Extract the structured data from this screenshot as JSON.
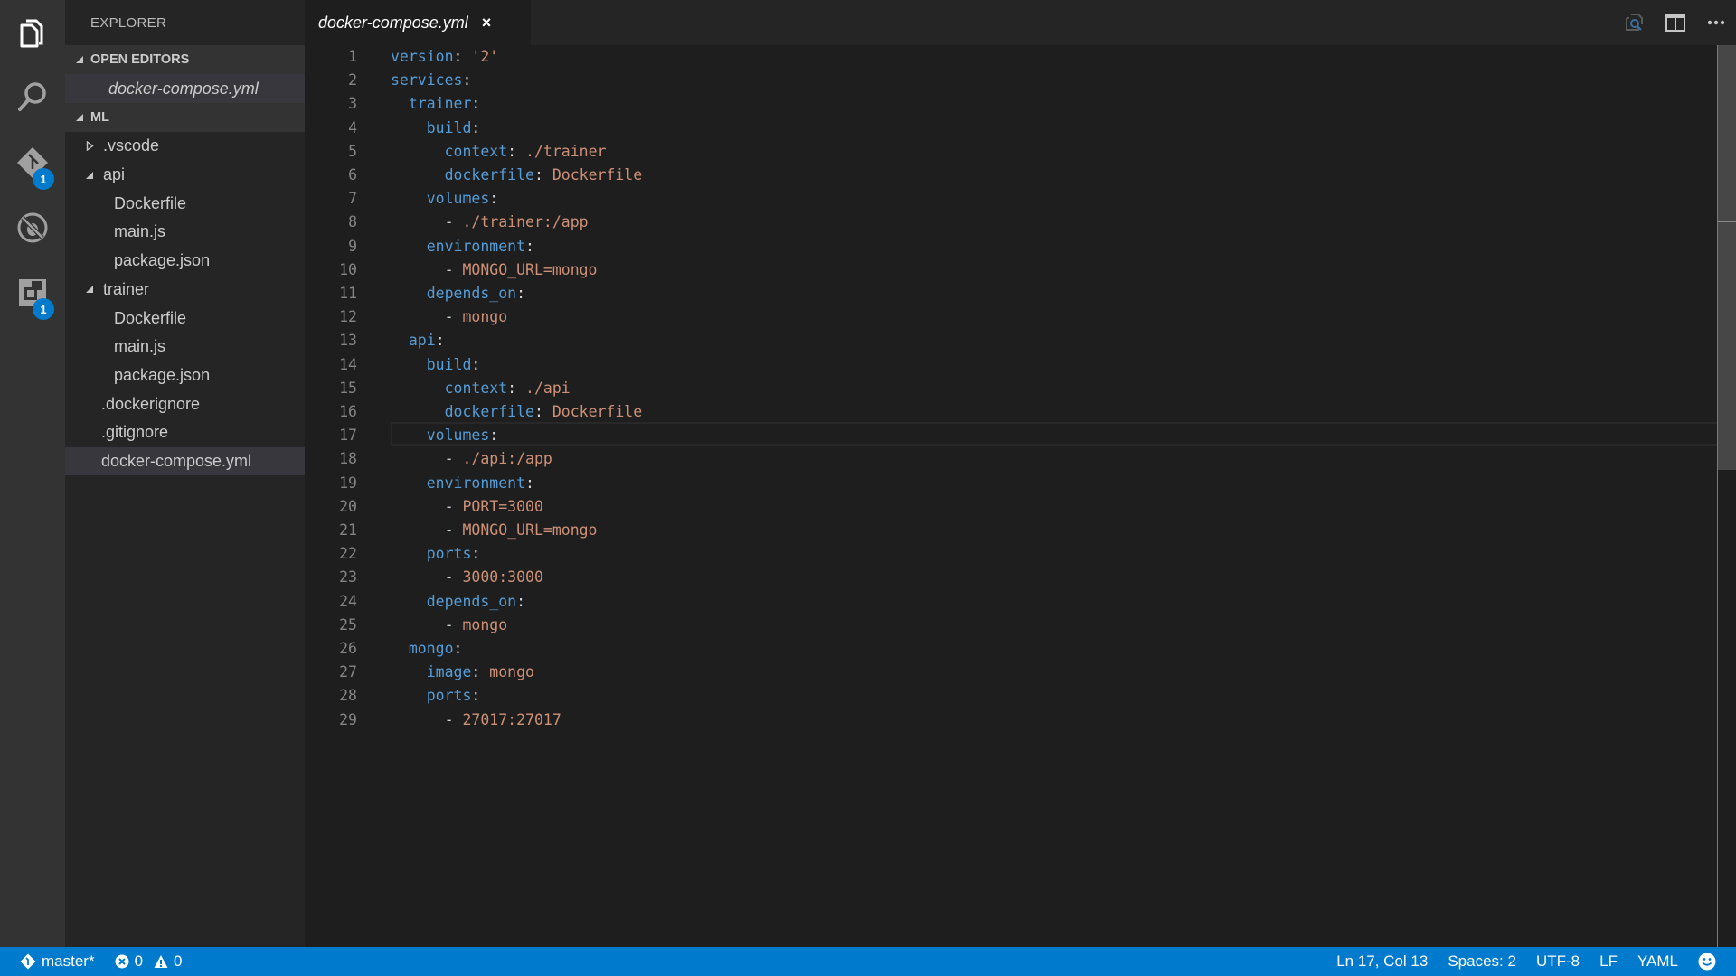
{
  "activitybar": {
    "items": [
      {
        "name": "explorer",
        "icon": "files-icon",
        "active": true
      },
      {
        "name": "search",
        "icon": "search-icon"
      },
      {
        "name": "source-control",
        "icon": "git-icon",
        "badge": "1"
      },
      {
        "name": "debug",
        "icon": "debug-icon"
      },
      {
        "name": "extensions",
        "icon": "extensions-icon",
        "badge": "1"
      }
    ]
  },
  "sidebar": {
    "title": "EXPLORER",
    "open_editors": {
      "header": "OPEN EDITORS",
      "items": [
        "docker-compose.yml"
      ]
    },
    "folder": {
      "header": "ML",
      "tree": [
        {
          "label": ".vscode",
          "type": "folder",
          "expanded": false,
          "depth": 0
        },
        {
          "label": "api",
          "type": "folder",
          "expanded": true,
          "depth": 0
        },
        {
          "label": "Dockerfile",
          "type": "file",
          "depth": 1
        },
        {
          "label": "main.js",
          "type": "file",
          "depth": 1
        },
        {
          "label": "package.json",
          "type": "file",
          "depth": 1
        },
        {
          "label": "trainer",
          "type": "folder",
          "expanded": true,
          "depth": 0
        },
        {
          "label": "Dockerfile",
          "type": "file",
          "depth": 1
        },
        {
          "label": "main.js",
          "type": "file",
          "depth": 1
        },
        {
          "label": "package.json",
          "type": "file",
          "depth": 1
        },
        {
          "label": ".dockerignore",
          "type": "file",
          "depth": 0
        },
        {
          "label": ".gitignore",
          "type": "file",
          "depth": 0
        },
        {
          "label": "docker-compose.yml",
          "type": "file",
          "depth": 0,
          "selected": true
        }
      ]
    }
  },
  "tabs": [
    {
      "label": "docker-compose.yml",
      "active": true,
      "close": "×"
    }
  ],
  "editor": {
    "current_line": 17,
    "lines": [
      [
        {
          "t": "version",
          "c": "k"
        },
        {
          "t": ": ",
          "c": "p"
        },
        {
          "t": "'2'",
          "c": "v"
        }
      ],
      [
        {
          "t": "services",
          "c": "k"
        },
        {
          "t": ":",
          "c": "p"
        }
      ],
      [
        {
          "t": "  "
        },
        {
          "t": "trainer",
          "c": "k"
        },
        {
          "t": ":",
          "c": "p"
        }
      ],
      [
        {
          "t": "    "
        },
        {
          "t": "build",
          "c": "k"
        },
        {
          "t": ":",
          "c": "p"
        }
      ],
      [
        {
          "t": "      "
        },
        {
          "t": "context",
          "c": "k"
        },
        {
          "t": ": ",
          "c": "p"
        },
        {
          "t": "./trainer",
          "c": "v"
        }
      ],
      [
        {
          "t": "      "
        },
        {
          "t": "dockerfile",
          "c": "k"
        },
        {
          "t": ": ",
          "c": "p"
        },
        {
          "t": "Dockerfile",
          "c": "v"
        }
      ],
      [
        {
          "t": "    "
        },
        {
          "t": "volumes",
          "c": "k"
        },
        {
          "t": ":",
          "c": "p"
        }
      ],
      [
        {
          "t": "      "
        },
        {
          "t": "- ",
          "c": "p"
        },
        {
          "t": "./trainer:/app",
          "c": "v"
        }
      ],
      [
        {
          "t": "    "
        },
        {
          "t": "environment",
          "c": "k"
        },
        {
          "t": ":",
          "c": "p"
        }
      ],
      [
        {
          "t": "      "
        },
        {
          "t": "- ",
          "c": "p"
        },
        {
          "t": "MONGO_URL=mongo",
          "c": "v"
        }
      ],
      [
        {
          "t": "    "
        },
        {
          "t": "depends_on",
          "c": "k"
        },
        {
          "t": ":",
          "c": "p"
        }
      ],
      [
        {
          "t": "      "
        },
        {
          "t": "- ",
          "c": "p"
        },
        {
          "t": "mongo",
          "c": "v"
        }
      ],
      [
        {
          "t": "  "
        },
        {
          "t": "api",
          "c": "k"
        },
        {
          "t": ":",
          "c": "p"
        }
      ],
      [
        {
          "t": "    "
        },
        {
          "t": "build",
          "c": "k"
        },
        {
          "t": ":",
          "c": "p"
        }
      ],
      [
        {
          "t": "      "
        },
        {
          "t": "context",
          "c": "k"
        },
        {
          "t": ": ",
          "c": "p"
        },
        {
          "t": "./api",
          "c": "v"
        }
      ],
      [
        {
          "t": "      "
        },
        {
          "t": "dockerfile",
          "c": "k"
        },
        {
          "t": ": ",
          "c": "p"
        },
        {
          "t": "Dockerfile",
          "c": "v"
        }
      ],
      [
        {
          "t": "    "
        },
        {
          "t": "volumes",
          "c": "k"
        },
        {
          "t": ":",
          "c": "p"
        }
      ],
      [
        {
          "t": "      "
        },
        {
          "t": "- ",
          "c": "p"
        },
        {
          "t": "./api:/app",
          "c": "v"
        }
      ],
      [
        {
          "t": "    "
        },
        {
          "t": "environment",
          "c": "k"
        },
        {
          "t": ":",
          "c": "p"
        }
      ],
      [
        {
          "t": "      "
        },
        {
          "t": "- ",
          "c": "p"
        },
        {
          "t": "PORT=3000",
          "c": "v"
        }
      ],
      [
        {
          "t": "      "
        },
        {
          "t": "- ",
          "c": "p"
        },
        {
          "t": "MONGO_URL=mongo",
          "c": "v"
        }
      ],
      [
        {
          "t": "    "
        },
        {
          "t": "ports",
          "c": "k"
        },
        {
          "t": ":",
          "c": "p"
        }
      ],
      [
        {
          "t": "      "
        },
        {
          "t": "- ",
          "c": "p"
        },
        {
          "t": "3000:3000",
          "c": "v"
        }
      ],
      [
        {
          "t": "    "
        },
        {
          "t": "depends_on",
          "c": "k"
        },
        {
          "t": ":",
          "c": "p"
        }
      ],
      [
        {
          "t": "      "
        },
        {
          "t": "- ",
          "c": "p"
        },
        {
          "t": "mongo",
          "c": "v"
        }
      ],
      [
        {
          "t": "  "
        },
        {
          "t": "mongo",
          "c": "k"
        },
        {
          "t": ":",
          "c": "p"
        }
      ],
      [
        {
          "t": "    "
        },
        {
          "t": "image",
          "c": "k"
        },
        {
          "t": ": ",
          "c": "p"
        },
        {
          "t": "mongo",
          "c": "v"
        }
      ],
      [
        {
          "t": "    "
        },
        {
          "t": "ports",
          "c": "k"
        },
        {
          "t": ":",
          "c": "p"
        }
      ],
      [
        {
          "t": "      "
        },
        {
          "t": "- ",
          "c": "p"
        },
        {
          "t": "27017:27017",
          "c": "v"
        }
      ]
    ]
  },
  "statusbar": {
    "branch": "master*",
    "errors": "0",
    "warnings": "0",
    "cursor": "Ln 17, Col 13",
    "indent": "Spaces: 2",
    "encoding": "UTF-8",
    "eol": "LF",
    "language": "YAML",
    "feedback_icon": "smiley-icon"
  },
  "colors": {
    "accent": "#007acc",
    "yaml_key": "#569cd6",
    "yaml_value": "#ce9178"
  }
}
